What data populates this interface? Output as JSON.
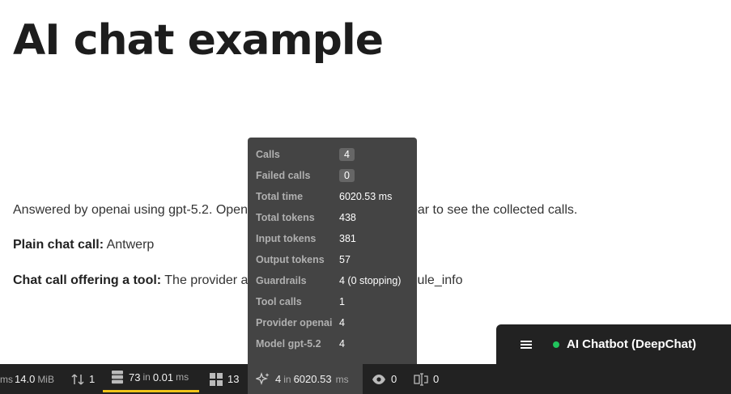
{
  "page": {
    "title": "AI chat example",
    "answer_line": "Answered by openai using gpt-5.2. Open the AI tab in the Profiler toolbar to see the collected calls.",
    "plain_chat_label": "Plain chat call:",
    "plain_chat_value": "Antwerp",
    "tool_chat_label": "Chat call offering a tool:",
    "tool_chat_value": "The provider answered via the tool get_module_info"
  },
  "ai_panel": {
    "rows": [
      {
        "label": "Calls",
        "value": "4"
      },
      {
        "label": "Failed calls",
        "value": "0"
      },
      {
        "label": "Total time",
        "value": "6020.53 ms"
      },
      {
        "label": "Total tokens",
        "value": "438"
      },
      {
        "label": "Input tokens",
        "value": "381"
      },
      {
        "label": "Output tokens",
        "value": "57"
      },
      {
        "label": "Guardrails",
        "value": "4 (0 stopping)"
      },
      {
        "label": "Tool calls",
        "value": "1"
      },
      {
        "label": "Provider openai",
        "value": "4"
      },
      {
        "label": "Model gpt-5.2",
        "value": "4"
      }
    ]
  },
  "toolbar": {
    "time_unit": "ms",
    "memory_value": "14.0",
    "memory_unit": "MiB",
    "requests_value": "1",
    "db_queries": "73",
    "db_in": "in",
    "db_time": "0.01",
    "db_unit": "ms",
    "components_value": "13",
    "ai_calls": "4",
    "ai_in": "in",
    "ai_time": "6020.53",
    "ai_unit": "ms",
    "views_value": "0",
    "translations_value": "0"
  },
  "chatbot": {
    "title": "AI Chatbot (DeepChat)",
    "status_color": "#21c45d"
  }
}
